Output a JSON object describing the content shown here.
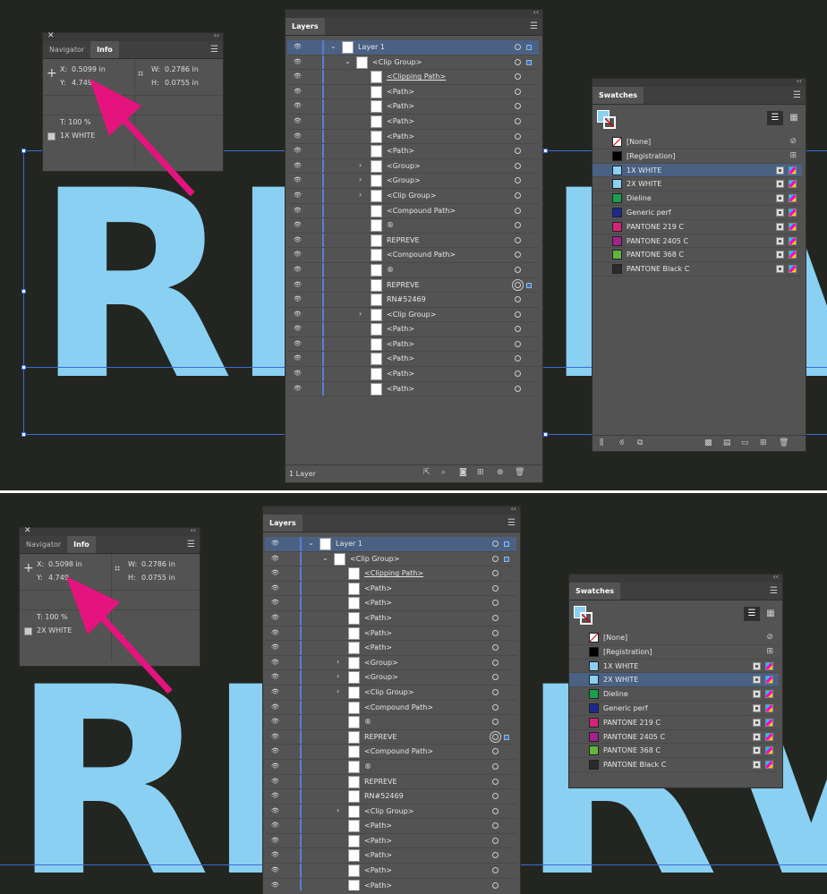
{
  "top": {
    "info": {
      "tabs": [
        "Navigator",
        "Info"
      ],
      "x_label": "X:",
      "x_value": "0.5099 in",
      "y_label": "Y:",
      "y_value": "4.749",
      "w_label": "W:",
      "w_value": "0.2786 in",
      "h_label": "H:",
      "h_value": "0.0755 in",
      "t_label": "T: 100 %",
      "swatch": "1X WHITE"
    },
    "layers": {
      "tab": "Layers",
      "count": "1 Layer",
      "rows": [
        {
          "label": "Layer 1",
          "indent": 0,
          "toggle": "⌄",
          "sel": true,
          "target": "square"
        },
        {
          "label": "<Clip Group>",
          "indent": 1,
          "toggle": "⌄",
          "target": "square"
        },
        {
          "label": "<Clipping Path>",
          "indent": 2,
          "underline": true
        },
        {
          "label": "<Path>",
          "indent": 2
        },
        {
          "label": "<Path>",
          "indent": 2
        },
        {
          "label": "<Path>",
          "indent": 2
        },
        {
          "label": "<Path>",
          "indent": 2
        },
        {
          "label": "<Path>",
          "indent": 2
        },
        {
          "label": "<Group>",
          "indent": 2,
          "toggle": "›"
        },
        {
          "label": "<Group>",
          "indent": 2,
          "toggle": "›"
        },
        {
          "label": "<Clip Group>",
          "indent": 2,
          "toggle": "›"
        },
        {
          "label": "<Compound Path>",
          "indent": 2
        },
        {
          "label": "®",
          "indent": 2
        },
        {
          "label": "REPREVE",
          "indent": 2
        },
        {
          "label": "<Compound Path>",
          "indent": 2
        },
        {
          "label": "®",
          "indent": 2
        },
        {
          "label": "REPREVE",
          "indent": 2,
          "target": "double"
        },
        {
          "label": "RN#52469",
          "indent": 2
        },
        {
          "label": "<Clip Group>",
          "indent": 2,
          "toggle": "›"
        },
        {
          "label": "<Path>",
          "indent": 2
        },
        {
          "label": "<Path>",
          "indent": 2
        },
        {
          "label": "<Path>",
          "indent": 2
        },
        {
          "label": "<Path>",
          "indent": 2
        },
        {
          "label": "<Path>",
          "indent": 2
        }
      ]
    },
    "swatches": {
      "tab": "Swatches",
      "rows": [
        {
          "label": "[None]",
          "color": "none"
        },
        {
          "label": "[Registration]",
          "color": "#000000"
        },
        {
          "label": "1X WHITE",
          "color": "#89d0f2",
          "sel": true
        },
        {
          "label": "2X WHITE",
          "color": "#89d0f2"
        },
        {
          "label": "Dieline",
          "color": "#19a04a"
        },
        {
          "label": "Generic perf",
          "color": "#1c2a8c"
        },
        {
          "label": "PANTONE 219 C",
          "color": "#d6237a"
        },
        {
          "label": "PANTONE 2405 C",
          "color": "#a3228c"
        },
        {
          "label": "PANTONE 368 C",
          "color": "#60b53a"
        },
        {
          "label": "PANTONE Black C",
          "color": "#2b2b2b"
        }
      ]
    }
  },
  "bottom": {
    "info": {
      "tabs": [
        "Navigator",
        "Info"
      ],
      "x_label": "X:",
      "x_value": "0.5098 in",
      "y_label": "Y:",
      "y_value": "4.749",
      "w_label": "W:",
      "w_value": "0.2786 in",
      "h_label": "H:",
      "h_value": "0.0755 in",
      "t_label": "T: 100 %",
      "swatch": "2X WHITE"
    },
    "layers": {
      "tab": "Layers",
      "rows": [
        {
          "label": "Layer 1",
          "indent": 0,
          "toggle": "⌄",
          "sel": true,
          "target": "square"
        },
        {
          "label": "<Clip Group>",
          "indent": 1,
          "toggle": "⌄",
          "target": "square"
        },
        {
          "label": "<Clipping Path>",
          "indent": 2,
          "underline": true
        },
        {
          "label": "<Path>",
          "indent": 2
        },
        {
          "label": "<Path>",
          "indent": 2
        },
        {
          "label": "<Path>",
          "indent": 2
        },
        {
          "label": "<Path>",
          "indent": 2
        },
        {
          "label": "<Path>",
          "indent": 2
        },
        {
          "label": "<Group>",
          "indent": 2,
          "toggle": "›"
        },
        {
          "label": "<Group>",
          "indent": 2,
          "toggle": "›"
        },
        {
          "label": "<Clip Group>",
          "indent": 2,
          "toggle": "›"
        },
        {
          "label": "<Compound Path>",
          "indent": 2
        },
        {
          "label": "®",
          "indent": 2
        },
        {
          "label": "REPREVE",
          "indent": 2,
          "target": "double"
        },
        {
          "label": "<Compound Path>",
          "indent": 2
        },
        {
          "label": "®",
          "indent": 2
        },
        {
          "label": "REPREVE",
          "indent": 2
        },
        {
          "label": "RN#52469",
          "indent": 2
        },
        {
          "label": "<Clip Group>",
          "indent": 2,
          "toggle": "›"
        },
        {
          "label": "<Path>",
          "indent": 2
        },
        {
          "label": "<Path>",
          "indent": 2
        },
        {
          "label": "<Path>",
          "indent": 2
        },
        {
          "label": "<Path>",
          "indent": 2
        },
        {
          "label": "<Path>",
          "indent": 2
        }
      ]
    },
    "swatches": {
      "tab": "Swatches",
      "rows": [
        {
          "label": "[None]",
          "color": "none"
        },
        {
          "label": "[Registration]",
          "color": "#000000"
        },
        {
          "label": "1X WHITE",
          "color": "#89d0f2"
        },
        {
          "label": "2X WHITE",
          "color": "#89d0f2",
          "sel": true
        },
        {
          "label": "Dieline",
          "color": "#19a04a"
        },
        {
          "label": "Generic perf",
          "color": "#1c2a8c"
        },
        {
          "label": "PANTONE 219 C",
          "color": "#d6237a"
        },
        {
          "label": "PANTONE 2405 C",
          "color": "#a3228c"
        },
        {
          "label": "PANTONE 368 C",
          "color": "#60b53a"
        },
        {
          "label": "PANTONE Black C",
          "color": "#2b2b2b"
        }
      ]
    }
  },
  "canvas": {
    "artwork_left": "RE",
    "artwork_right": "R",
    "artwork_right2": "V"
  },
  "colors": {
    "artwork": "#89d0f2",
    "arrow": "#e5137e",
    "background": "#232620",
    "selection": "#4a6184"
  }
}
